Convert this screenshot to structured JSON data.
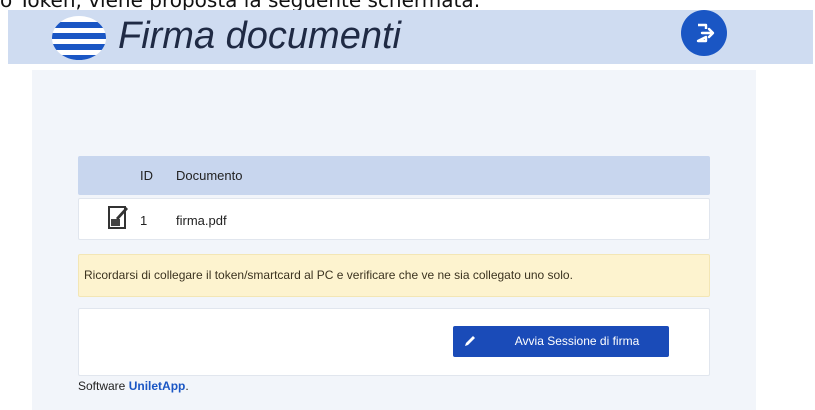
{
  "document_caption": "o Token, viene proposta la seguente schermata:",
  "header": {
    "title": "Firma documenti",
    "menu_icon": "hamburger-menu-icon",
    "logout_icon": "logout-icon",
    "colors": {
      "bar": "#cfdcf1",
      "accent": "#1a56c4"
    }
  },
  "table": {
    "columns": [
      "ID",
      "Documento"
    ],
    "rows": [
      {
        "icon": "pdf-sign-icon",
        "id": "1",
        "document": "firma.pdf"
      }
    ]
  },
  "alert": {
    "text": "Ricordarsi di collegare il token/smartcard al PC e verificare che ve ne sia collegato uno solo."
  },
  "actions": {
    "start_signing_label": "Avvia Sessione di firma",
    "icon": "pen-icon"
  },
  "footer": {
    "prefix": "Software",
    "brand": "UniletApp",
    "suffix": "."
  }
}
